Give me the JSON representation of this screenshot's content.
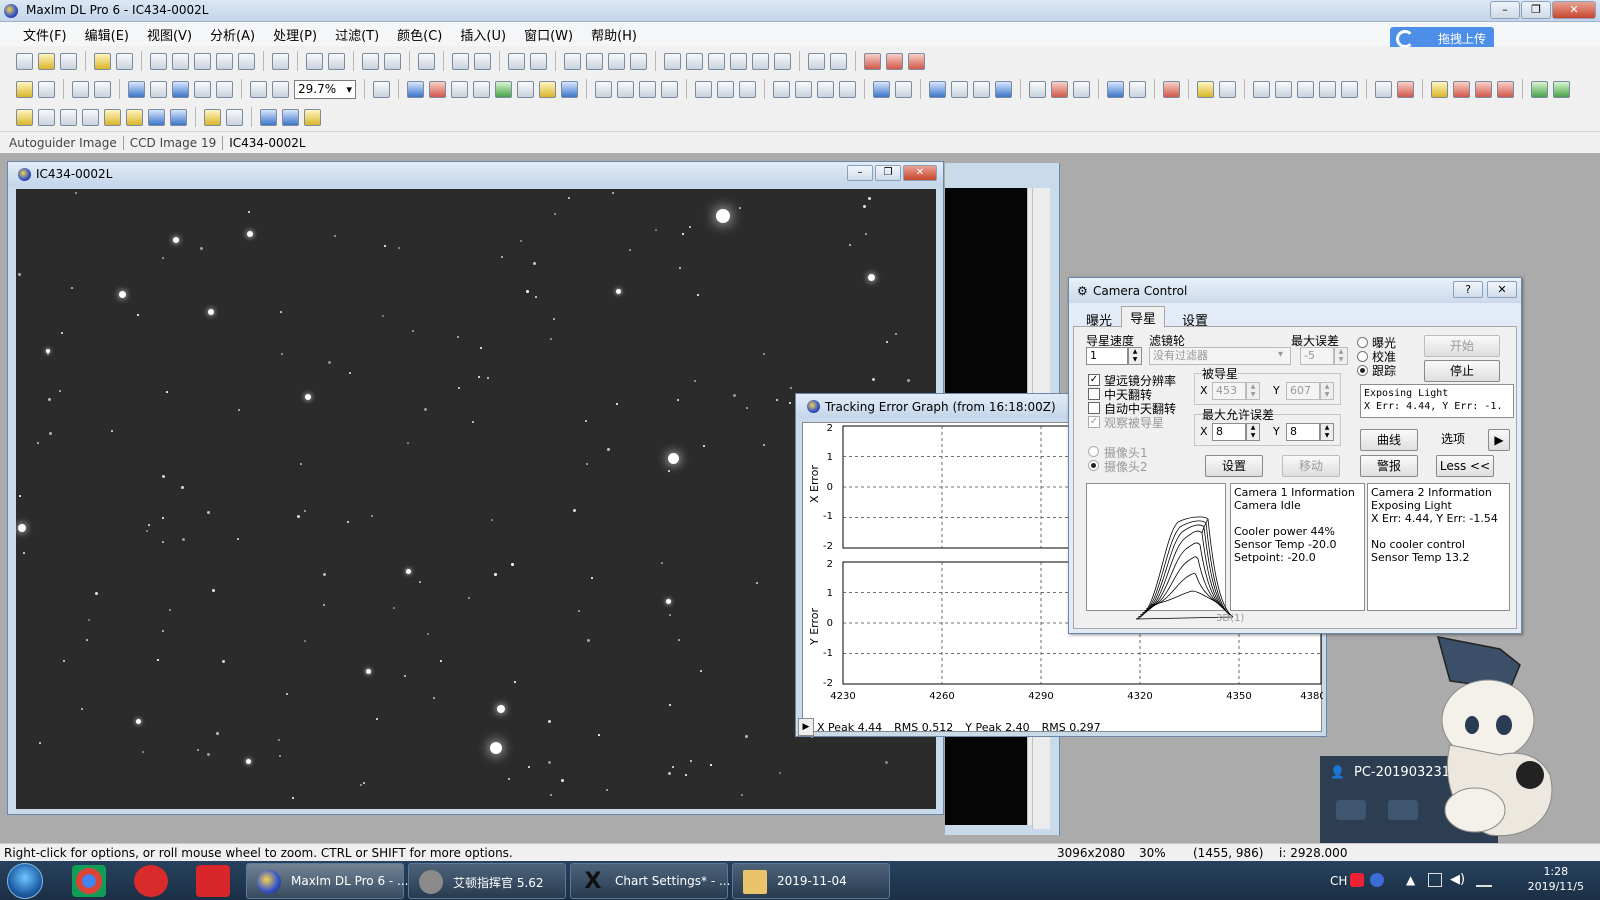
{
  "app": {
    "title": "MaxIm DL Pro 6 - IC434-0002L",
    "window_controls": [
      "–",
      "❐",
      "✕"
    ]
  },
  "menu": [
    "文件(F)",
    "编辑(E)",
    "视图(V)",
    "分析(A)",
    "处理(P)",
    "过滤(T)",
    "颜色(C)",
    "插入(U)",
    "窗口(W)",
    "帮助(H)"
  ],
  "upload_button": "拖拽上传",
  "toolbar": {
    "zoom": "29.7%"
  },
  "image_tabs": [
    "Autoguider Image",
    "CCD Image 19",
    "IC434-0002L"
  ],
  "image_window": {
    "title": "IC434-0002L"
  },
  "tracking_graph": {
    "title": "Tracking Error Graph (from 16:18:00Z)",
    "x_axis_label": "X Error",
    "y_axis_label": "Y Error",
    "y_ticks": [
      "2",
      "1",
      "0",
      "-1",
      "-2"
    ],
    "x_ticks": [
      "4230",
      "4260",
      "4290",
      "4320",
      "4350",
      "4380"
    ],
    "status": {
      "x_peak": "X Peak 4.44",
      "x_rms": "RMS 0.512",
      "y_peak": "Y Peak 2.40",
      "y_rms": "RMS 0.297"
    }
  },
  "camera_control": {
    "title": "Camera Control",
    "help": "?",
    "close": "✕",
    "tabs": [
      "曝光",
      "导星",
      "设置"
    ],
    "active_tab": "导星",
    "labels": {
      "guide_speed": "导星速度",
      "filter_wheel": "滤镜轮",
      "max_error": "最大误差",
      "guided_star": "被导星",
      "max_allowed_error": "最大允许误差"
    },
    "guide_speed_value": "1",
    "filter_value": "没有过滤器",
    "max_error_value": "-5",
    "star_x": "453",
    "star_y": "607",
    "allowed_x": "8",
    "allowed_y": "8",
    "x_label": "X",
    "y_label": "Y",
    "modes": [
      "曝光",
      "校准",
      "跟踪"
    ],
    "selected_mode": "跟踪",
    "checkboxes": [
      {
        "label": "望远镜分辨率",
        "checked": true
      },
      {
        "label": "中天翻转",
        "checked": false
      },
      {
        "label": "自动中天翻转",
        "checked": false
      },
      {
        "label": "观察被导星",
        "checked": true,
        "disabled": true
      }
    ],
    "cameras": [
      "摄像头1",
      "摄像头2"
    ],
    "buttons": {
      "start": "开始",
      "stop": "停止",
      "settings": "设置",
      "move": "移动",
      "curve": "曲线",
      "options": "选项",
      "alarm": "警报",
      "less": "Less <<"
    },
    "status_box": "Exposing Light\nX Err: 4.44, Y Err: -1.",
    "thumb_label": "3D(1)",
    "camera1_info": "Camera 1 Information\nCamera Idle\n\nCooler power 44%\nSensor Temp -20.0\nSetpoint: -20.0",
    "camera2_info": "Camera 2 Information\nExposing Light\nX Err: 4.44, Y Err: -1.54\n\nNo cooler control\nSensor Temp 13.2"
  },
  "status_bar": {
    "hint": "Right-click for options, or roll mouse wheel to zoom. CTRL or SHIFT for more options.",
    "dimensions": "3096x2080",
    "zoom": "30%",
    "cursor": "(1455, 986)",
    "intensity": "i:  2928.000"
  },
  "qq_popup": {
    "user": "PC-20190323162"
  },
  "taskbar": {
    "tasks": [
      "MaxIm DL Pro 6 - ...",
      "艾顿指挥官 5.62",
      "Chart Settings* - ...",
      "2019-11-04"
    ],
    "tray_lang": "CH",
    "time": "1:28",
    "date": "2019/11/5"
  }
}
